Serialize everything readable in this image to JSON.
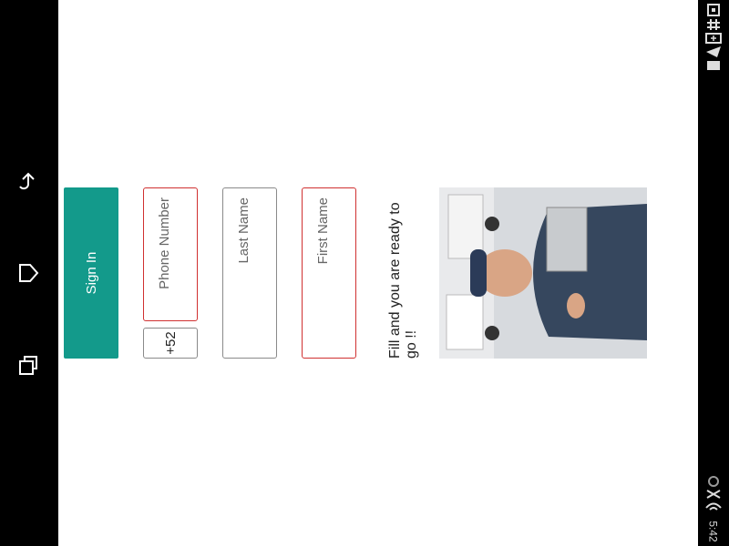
{
  "nav": {
    "back_icon": "back-arrow-icon",
    "home_icon": "home-icon",
    "recents_icon": "recents-icon"
  },
  "status_bar": {
    "time": "5:42",
    "icons": [
      "screenshot-icon",
      "hash-icon",
      "battery-plus-icon",
      "send-icon",
      "square-icon",
      "wifi-icon",
      "signal-icon",
      "bluetooth-icon"
    ]
  },
  "form": {
    "tagline": "Fill and you are ready to go !!",
    "first_name_placeholder": "First Name",
    "last_name_placeholder": "Last Name",
    "country_code": "+52",
    "phone_placeholder": "Phone Number",
    "sign_in_label": "Sign In"
  },
  "colors": {
    "accent": "#139a8b",
    "error_border": "#d03030",
    "neutral_border": "#8a8a8a"
  }
}
